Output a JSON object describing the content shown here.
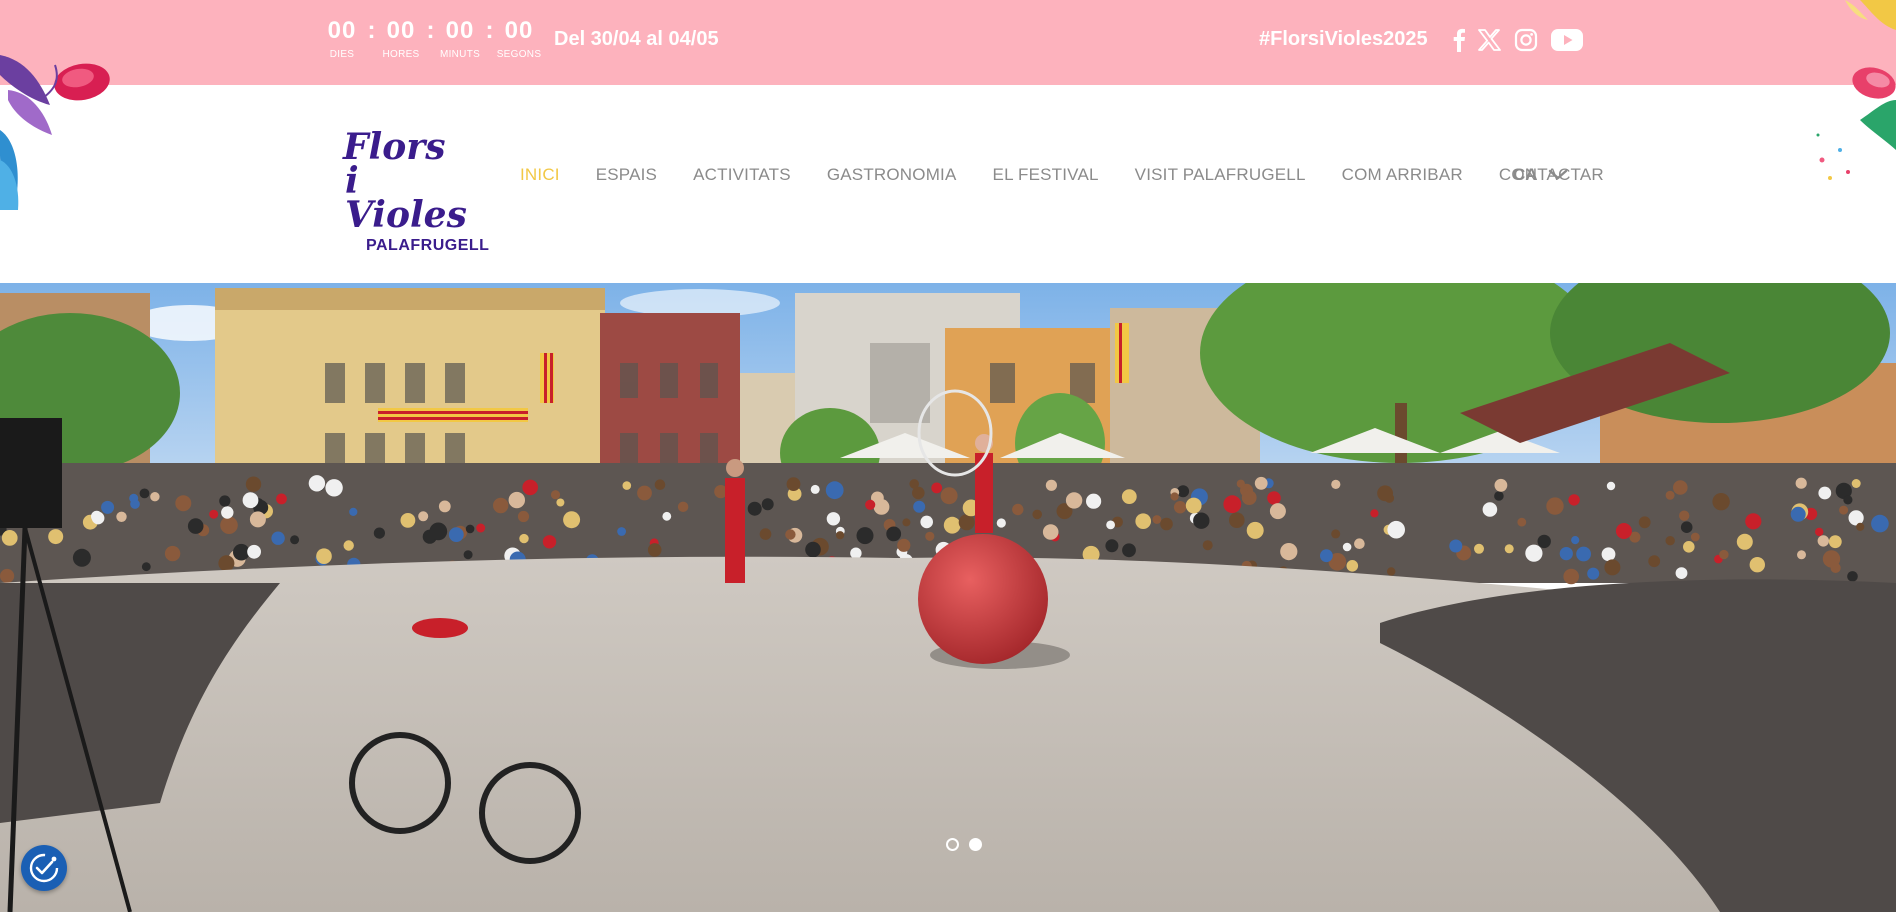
{
  "topbar": {
    "countdown": [
      {
        "value": "00",
        "label": "DIES"
      },
      {
        "value": "00",
        "label": "HORES"
      },
      {
        "value": "00",
        "label": "MINUTS"
      },
      {
        "value": "00",
        "label": "SEGONS"
      }
    ],
    "separator": ":",
    "dates": "Del 30/04 al 04/05",
    "hashtag": "#FlorsiVioles2025",
    "social": [
      "facebook-icon",
      "x-icon",
      "instagram-icon",
      "youtube-icon"
    ]
  },
  "header": {
    "logo": {
      "line1": "Flors",
      "line2": "i Violes",
      "line3": "PALAFRUGELL"
    },
    "nav": [
      {
        "label": "INICI",
        "active": true
      },
      {
        "label": "ESPAIS"
      },
      {
        "label": "ACTIVITATS"
      },
      {
        "label": "GASTRONOMIA"
      },
      {
        "label": "EL FESTIVAL"
      },
      {
        "label": "VISIT PALAFRUGELL"
      },
      {
        "label": "COM ARRIBAR"
      },
      {
        "label": "CONTACTAR"
      }
    ],
    "language": "CA"
  },
  "colors": {
    "topbar_bg": "#fdb2bd",
    "nav_text": "#8b8b8b",
    "nav_active": "#f2c845",
    "logo": "#3a1c8c",
    "consent_button": "#1a5fb4"
  },
  "hero": {
    "slides_count": 2,
    "active_slide": 2
  }
}
